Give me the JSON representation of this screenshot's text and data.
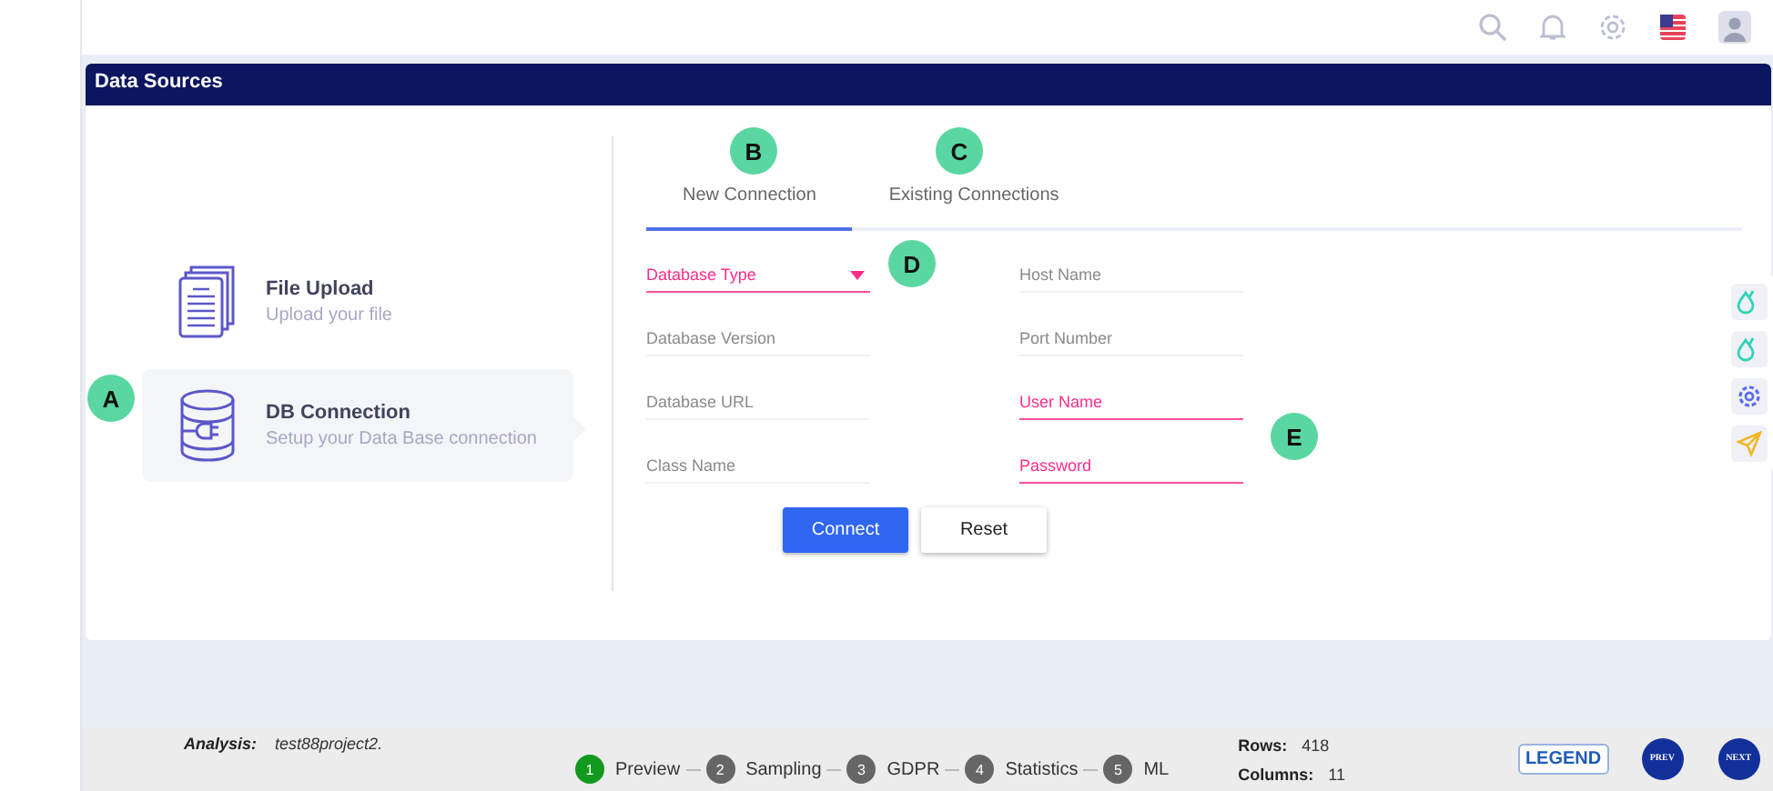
{
  "panel": {
    "title": "Data Sources"
  },
  "sources": [
    {
      "title": "File Upload",
      "subtitle": "Upload your file",
      "kind": "file",
      "selected": false
    },
    {
      "title": "DB Connection",
      "subtitle": "Setup your Data Base connection",
      "kind": "db",
      "selected": true
    }
  ],
  "tabs": [
    {
      "label": "New Connection",
      "selected": true
    },
    {
      "label": "Existing Connections",
      "selected": false
    }
  ],
  "fields": [
    {
      "placeholder": "Database Type",
      "invalid": true,
      "kind": "select"
    },
    {
      "placeholder": "Host Name",
      "invalid": false,
      "kind": "text"
    },
    {
      "placeholder": "Database Version",
      "invalid": false,
      "kind": "text"
    },
    {
      "placeholder": "Port Number",
      "invalid": false,
      "kind": "text"
    },
    {
      "placeholder": "Database URL",
      "invalid": false,
      "kind": "text"
    },
    {
      "placeholder": "User Name",
      "invalid": true,
      "kind": "text"
    },
    {
      "placeholder": "Class Name",
      "invalid": false,
      "kind": "text"
    },
    {
      "placeholder": "Password",
      "invalid": true,
      "kind": "password"
    }
  ],
  "buttons": [
    {
      "label": "Connect",
      "kind": "primary"
    },
    {
      "label": "Reset",
      "kind": "secondary"
    }
  ],
  "callouts": [
    {
      "label": "A"
    },
    {
      "label": "B"
    },
    {
      "label": "C"
    },
    {
      "label": "D"
    },
    {
      "label": "E"
    }
  ],
  "footer": {
    "analysis_label": "Analysis:",
    "analysis_value": "test88project2.",
    "steps": [
      {
        "number": "1",
        "label": "Preview",
        "selected": true
      },
      {
        "number": "2",
        "label": "Sampling",
        "selected": false
      },
      {
        "number": "3",
        "label": "GDPR",
        "selected": false
      },
      {
        "number": "4",
        "label": "Statistics",
        "selected": false
      },
      {
        "number": "5",
        "label": "ML",
        "selected": false
      }
    ],
    "stats": [
      {
        "label": "Rows:",
        "value": "418"
      },
      {
        "label": "Columns:",
        "value": "11"
      }
    ],
    "legend": "LEGEND",
    "prev": "PREV",
    "next": "NEXT"
  }
}
